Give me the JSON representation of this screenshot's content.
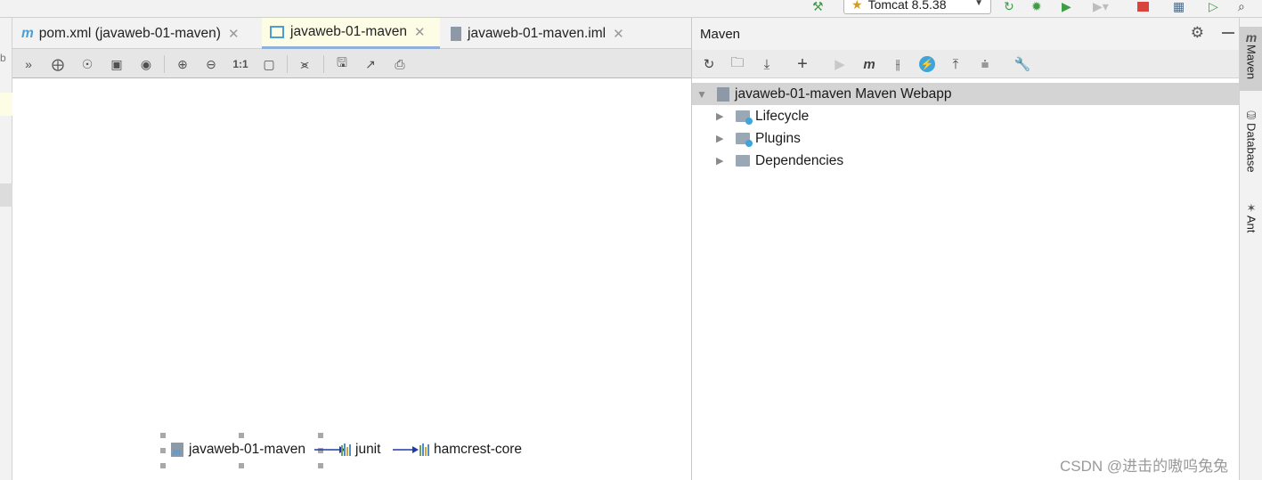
{
  "run_toolbar": {
    "run_config": "Tomcat 8.5.38",
    "icons": [
      "hammer-icon",
      "reload-icon",
      "debug-icon",
      "coverage-icon",
      "profile-icon",
      "stop-icon",
      "layout-icon",
      "terminal-icon",
      "search-icon"
    ]
  },
  "editor_tabs": [
    {
      "label": "pom.xml (javaweb-01-maven)",
      "icon": "maven-m-icon",
      "active": false
    },
    {
      "label": "javaweb-01-maven",
      "icon": "diagram-icon",
      "active": true
    },
    {
      "label": "javaweb-01-maven.iml",
      "icon": "module-file-icon",
      "active": false
    }
  ],
  "diagram": {
    "nodes": [
      "javaweb-01-maven",
      "junit",
      "hamcrest-core"
    ],
    "colors": {
      "edge": "#1f3aa6",
      "handle": "#a8a8a8"
    }
  },
  "maven": {
    "title": "Maven",
    "tree": {
      "root": "javaweb-01-maven Maven Webapp",
      "children": [
        "Lifecycle",
        "Plugins",
        "Dependencies"
      ]
    },
    "toolbar_icons": [
      "reload-icon",
      "generate-sources-icon",
      "download-icon",
      "add-icon",
      "run-icon",
      "maven-goal-icon",
      "toggle-offline-icon",
      "skip-tests-icon",
      "show-dependencies-icon",
      "collapse-all-icon",
      "settings-wrench-icon"
    ]
  },
  "side_tabs": [
    "Maven",
    "Database",
    "Ant"
  ],
  "watermark": "CSDN @进击的嗷呜兔兔",
  "colors": {
    "accent": "#3da5d9",
    "selection": "#d4d4d4",
    "active_tab": "#fdfde6"
  }
}
